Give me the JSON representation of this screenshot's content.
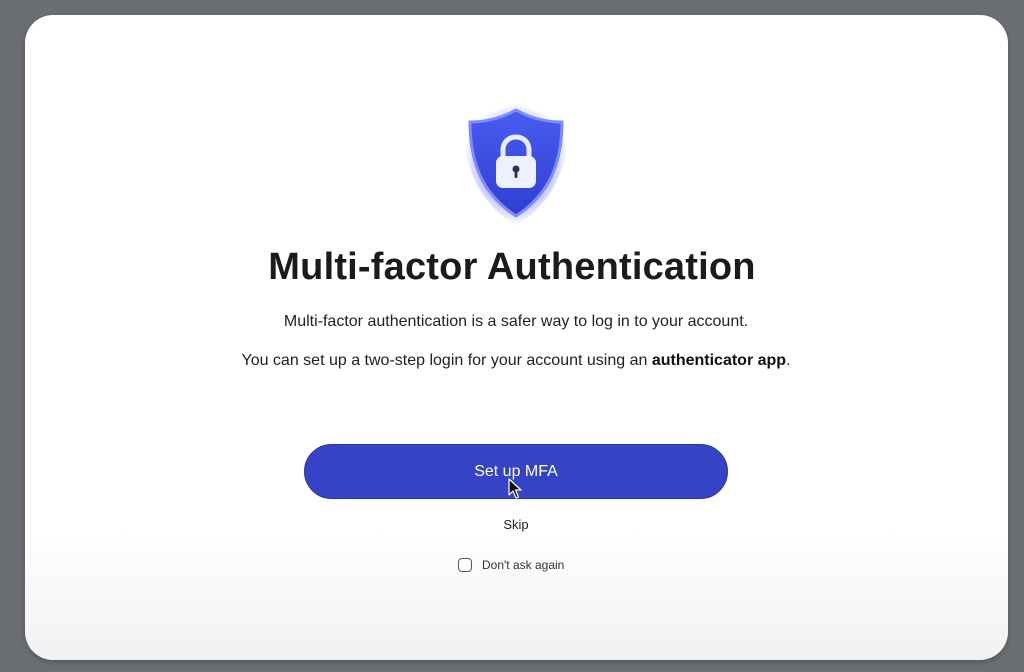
{
  "dialog": {
    "title": "Multi-factor Authentication",
    "line1": "Multi-factor authentication is a safer way to log in to your account.",
    "line2_prefix": "You can set up a two-step login for your account using an ",
    "line2_bold": "authenticator app",
    "line2_suffix": ".",
    "primary_button": "Set up MFA",
    "skip_link": "Skip",
    "checkbox_label": "Don't ask again",
    "checkbox_checked": false
  },
  "icons": {
    "shield": "shield-lock-icon",
    "cursor": "mouse-cursor-icon"
  },
  "colors": {
    "primary": "#3543c5",
    "shield_blue": "#3a4fe0",
    "backdrop": "#6b6f74"
  }
}
